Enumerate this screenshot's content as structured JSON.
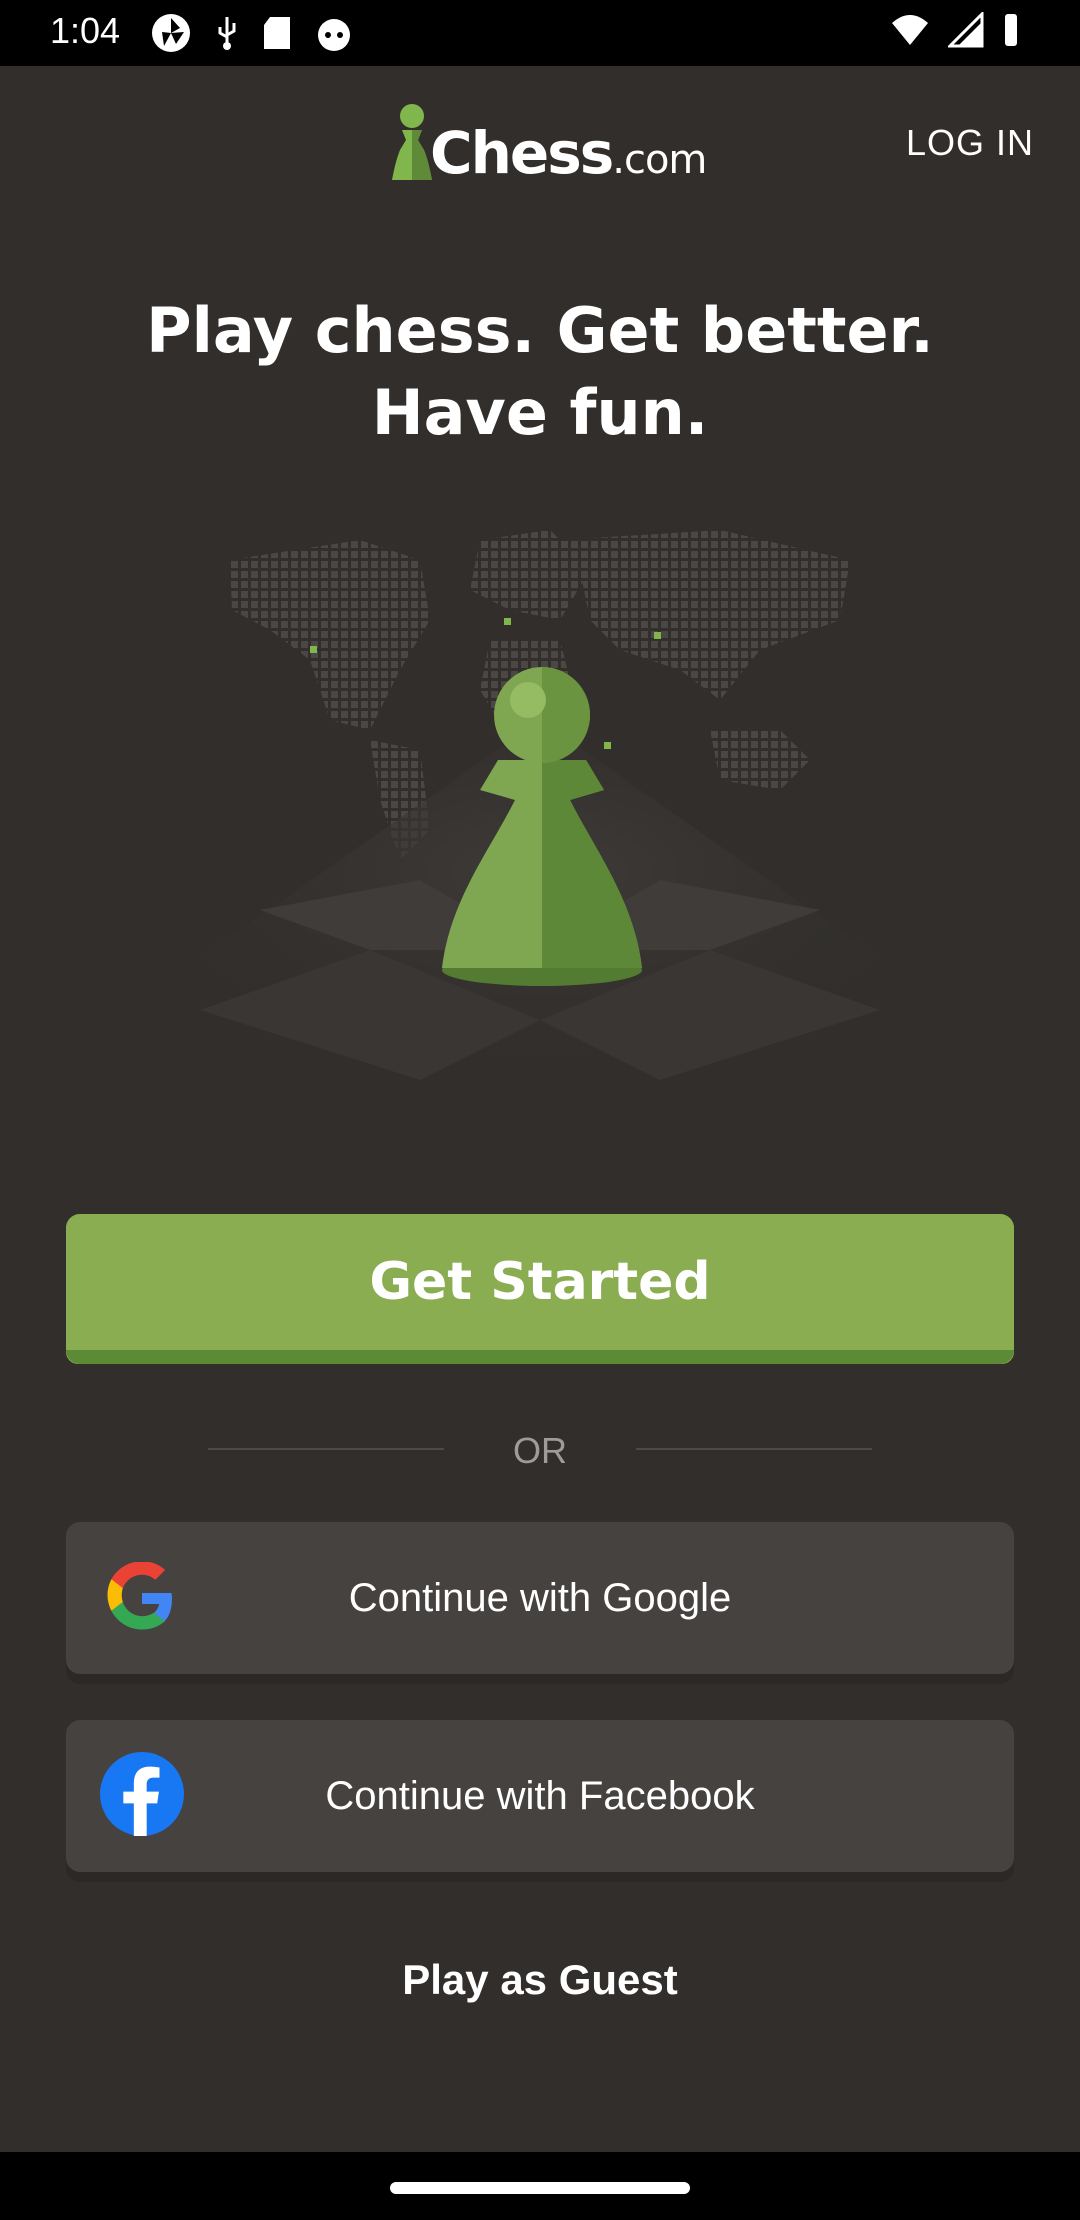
{
  "status_bar": {
    "time": "1:04",
    "left_icons": [
      "camera-aperture-icon",
      "usb-icon",
      "sd-card-icon",
      "android-icon"
    ],
    "right_icons": [
      "wifi-icon",
      "signal-icon",
      "battery-icon"
    ]
  },
  "header": {
    "logo_main": "Chess",
    "logo_suffix": ".com",
    "login_label": "LOG IN"
  },
  "headline": {
    "line1": "Play chess. Get better.",
    "line2": "Have fun."
  },
  "buttons": {
    "get_started": "Get Started",
    "or_label": "OR",
    "google": "Continue with Google",
    "facebook": "Continue with Facebook",
    "guest": "Play as Guest"
  },
  "colors": {
    "background": "#312e2b",
    "brand_green": "#81b64c",
    "social_button": "#454240"
  }
}
